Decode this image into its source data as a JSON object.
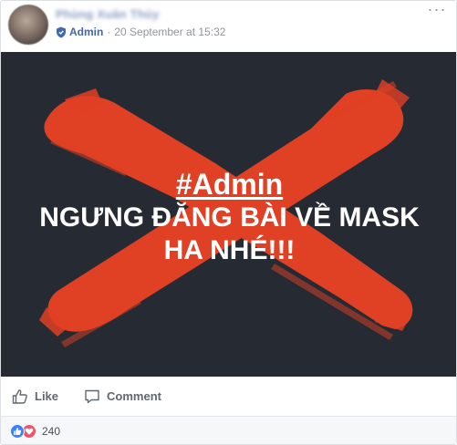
{
  "post": {
    "author_name": "Phùng Xuân Thủy",
    "badge_label": "Admin",
    "separator": "·",
    "timestamp": "20 September at 15:32",
    "more_label": "···"
  },
  "image": {
    "hashtag": "#Admin",
    "line1": "NGƯNG ĐĂNG BÀI VỀ MASK",
    "line2": "HA NHÉ!!!",
    "background_color": "#252a33",
    "cross_color": "#e04023"
  },
  "actions": {
    "like_label": "Like",
    "comment_label": "Comment"
  },
  "reactions": {
    "icons": [
      "like-icon",
      "love-icon"
    ],
    "count": "240"
  }
}
